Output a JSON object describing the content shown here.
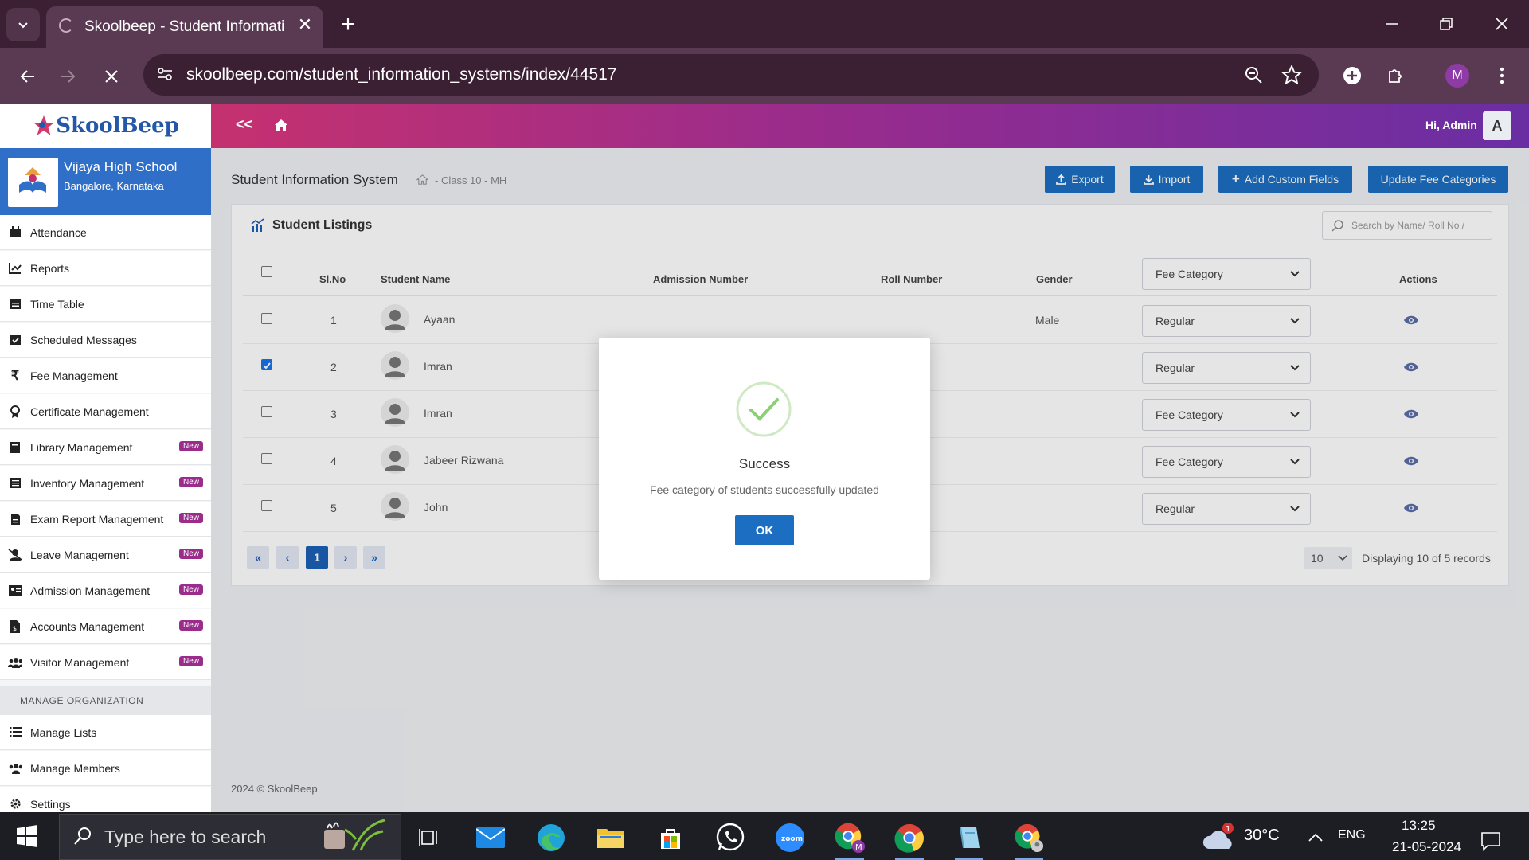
{
  "browser": {
    "tab_title": "Skoolbeep - Student Informatio",
    "url": "skoolbeep.com/student_information_systems/index/44517",
    "profile_initial": "M"
  },
  "app": {
    "logo": "SkoolBeep",
    "school_name": "Vijaya High School",
    "school_location": "Bangalore, Karnataka",
    "collapse_label": "<<",
    "greeting": "Hi,  Admin",
    "admin_initial": "A",
    "brand_color": "#1b6ec2",
    "accent_color": "#9a2c8c"
  },
  "sidebar": {
    "items": [
      {
        "label": "Attendance",
        "icon": "calendar-icon",
        "new": ""
      },
      {
        "label": "Reports",
        "icon": "chart-line-icon",
        "new": ""
      },
      {
        "label": "Time Table",
        "icon": "timetable-icon",
        "new": ""
      },
      {
        "label": "Scheduled Messages",
        "icon": "calendar-check-icon",
        "new": ""
      },
      {
        "label": "Fee Management",
        "icon": "rupee-icon",
        "new": ""
      },
      {
        "label": "Certificate Management",
        "icon": "certificate-icon",
        "new": ""
      },
      {
        "label": "Library Management",
        "icon": "book-icon",
        "new": "New"
      },
      {
        "label": "Inventory Management",
        "icon": "list-icon",
        "new": "New"
      },
      {
        "label": "Exam Report Management",
        "icon": "report-icon",
        "new": "New"
      },
      {
        "label": "Leave Management",
        "icon": "user-slash-icon",
        "new": "New"
      },
      {
        "label": "Admission Management",
        "icon": "id-card-icon",
        "new": "New"
      },
      {
        "label": "Accounts Management",
        "icon": "file-invoice-icon",
        "new": "New"
      },
      {
        "label": "Visitor Management",
        "icon": "users-icon",
        "new": "New"
      }
    ],
    "section_label": "MANAGE ORGANIZATION",
    "org_items": [
      {
        "label": "Manage Lists",
        "icon": "list-ul-icon"
      },
      {
        "label": "Manage Members",
        "icon": "users-icon"
      },
      {
        "label": "Settings",
        "icon": "gear-icon"
      }
    ]
  },
  "page": {
    "title": "Student Information System",
    "breadcrumb": "- Class 10 - MH",
    "buttons": {
      "export": "Export",
      "import": "Import",
      "add_custom_fields": "Add Custom Fields",
      "update_fee": "Update Fee Categories"
    }
  },
  "listing": {
    "title": "Student Listings",
    "search_placeholder": "Search by Name/ Roll No /",
    "columns": [
      "Sl.No",
      "Student Name",
      "Admission Number",
      "Roll Number",
      "Gender",
      "Fee Category",
      "Actions"
    ],
    "rows": [
      {
        "sl": "1",
        "name": "Ayaan",
        "admission": "",
        "roll": "",
        "gender": "Male",
        "fee": "Regular",
        "checked": false
      },
      {
        "sl": "2",
        "name": "Imran",
        "admission": "",
        "roll": "",
        "gender": "",
        "fee": "Regular",
        "checked": true
      },
      {
        "sl": "3",
        "name": "Imran",
        "admission": "",
        "roll": "",
        "gender": "",
        "fee": "Fee Category",
        "checked": false
      },
      {
        "sl": "4",
        "name": "Jabeer Rizwana",
        "admission": "",
        "roll": "",
        "gender": "",
        "fee": "Fee Category",
        "checked": false
      },
      {
        "sl": "5",
        "name": "John",
        "admission": "",
        "roll": "",
        "gender": "",
        "fee": "Regular",
        "checked": false
      }
    ],
    "pagination": {
      "first": "«",
      "prev": "‹",
      "current": "1",
      "next": "›",
      "last": "»"
    },
    "page_size": "10",
    "records_text": "Displaying 10 of 5 records"
  },
  "footer": "2024 © SkoolBeep",
  "modal": {
    "title": "Success",
    "message": "Fee category of students successfully updated",
    "ok": "OK"
  },
  "taskbar": {
    "search_placeholder": "Type here to search",
    "weather": "30°C",
    "weather_badge": "1",
    "language": "ENG",
    "time": "13:25",
    "date": "21-05-2024"
  }
}
